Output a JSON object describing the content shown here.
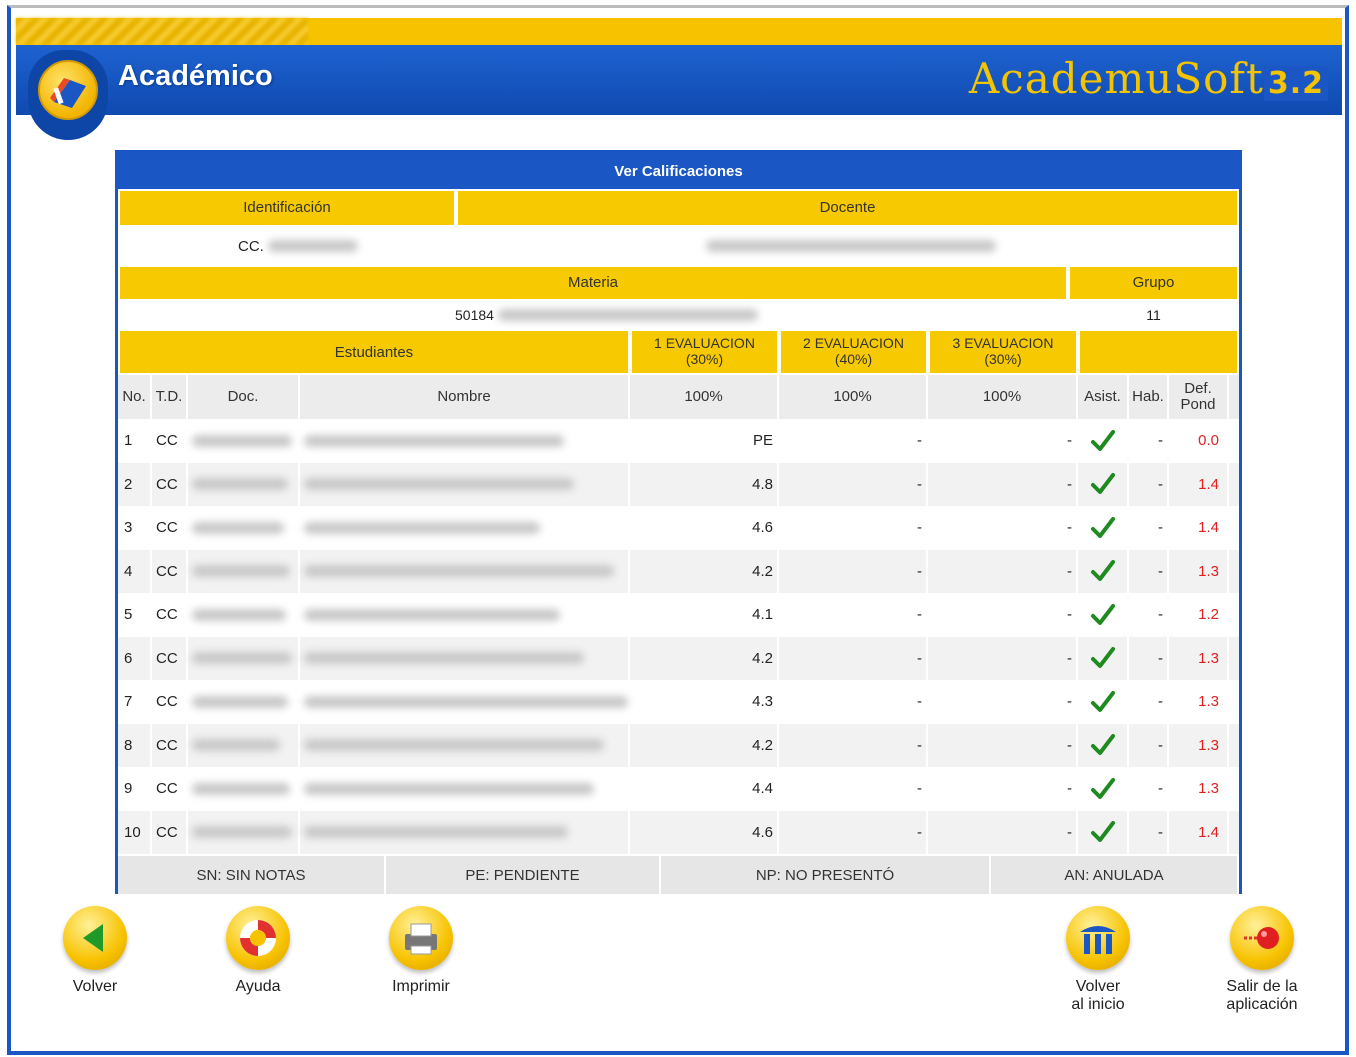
{
  "app": {
    "title": "Académico",
    "brand": "AcademuSoft",
    "brand_version": "3.2"
  },
  "panel": {
    "title": "Ver Calificaciones",
    "identificacion_label": "Identificación",
    "docente_label": "Docente",
    "identificacion_value": "CC.",
    "materia_label": "Materia",
    "grupo_label": "Grupo",
    "materia_value": "50184",
    "grupo_value": "11"
  },
  "table": {
    "estudiantes_label": "Estudiantes",
    "eval1": {
      "line1": "1 EVALUACION",
      "line2": "(30%)"
    },
    "eval2": {
      "line1": "2 EVALUACION",
      "line2": "(40%)"
    },
    "eval3": {
      "line1": "3 EVALUACION",
      "line2": "(30%)"
    },
    "columns": {
      "no": "No.",
      "td": "T.D.",
      "doc": "Doc.",
      "nombre": "Nombre",
      "e1": "100%",
      "e2": "100%",
      "e3": "100%",
      "asist": "Asist.",
      "hab": "Hab.",
      "def1": "Def.",
      "def2": "Pond"
    },
    "rows": [
      {
        "no": "1",
        "td": "CC",
        "e1": "PE",
        "e2": "-",
        "e3": "-",
        "hab": "-",
        "def": "0.0"
      },
      {
        "no": "2",
        "td": "CC",
        "e1": "4.8",
        "e2": "-",
        "e3": "-",
        "hab": "-",
        "def": "1.4"
      },
      {
        "no": "3",
        "td": "CC",
        "e1": "4.6",
        "e2": "-",
        "e3": "-",
        "hab": "-",
        "def": "1.4"
      },
      {
        "no": "4",
        "td": "CC",
        "e1": "4.2",
        "e2": "-",
        "e3": "-",
        "hab": "-",
        "def": "1.3"
      },
      {
        "no": "5",
        "td": "CC",
        "e1": "4.1",
        "e2": "-",
        "e3": "-",
        "hab": "-",
        "def": "1.2"
      },
      {
        "no": "6",
        "td": "CC",
        "e1": "4.2",
        "e2": "-",
        "e3": "-",
        "hab": "-",
        "def": "1.3"
      },
      {
        "no": "7",
        "td": "CC",
        "e1": "4.3",
        "e2": "-",
        "e3": "-",
        "hab": "-",
        "def": "1.3"
      },
      {
        "no": "8",
        "td": "CC",
        "e1": "4.2",
        "e2": "-",
        "e3": "-",
        "hab": "-",
        "def": "1.3"
      },
      {
        "no": "9",
        "td": "CC",
        "e1": "4.4",
        "e2": "-",
        "e3": "-",
        "hab": "-",
        "def": "1.3"
      },
      {
        "no": "10",
        "td": "CC",
        "e1": "4.6",
        "e2": "-",
        "e3": "-",
        "hab": "-",
        "def": "1.4"
      }
    ],
    "legend": {
      "sn": "SN: SIN NOTAS",
      "pe": "PE: PENDIENTE",
      "np": "NP: NO PRESENTÓ",
      "an": "AN: ANULADA"
    }
  },
  "toolbar": {
    "volver": "Volver",
    "ayuda": "Ayuda",
    "imprimir": "Imprimir",
    "volver_inicio_1": "Volver",
    "volver_inicio_2": "al inicio",
    "salir_1": "Salir de la",
    "salir_2": "aplicación"
  },
  "colors": {
    "header_blue": "#1a56c4",
    "accent_yellow": "#f7c900",
    "def_red": "#e02020",
    "check_green": "#1f8a1f"
  }
}
